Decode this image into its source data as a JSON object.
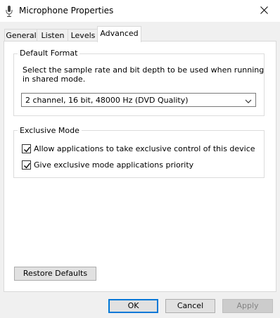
{
  "window": {
    "title": "Microphone Properties",
    "icon": "microphone-icon",
    "close_icon": "close-icon"
  },
  "tabs": [
    {
      "label": "General",
      "active": false
    },
    {
      "label": "Listen",
      "active": false
    },
    {
      "label": "Levels",
      "active": false
    },
    {
      "label": "Advanced",
      "active": true
    }
  ],
  "default_format": {
    "group_label": "Default Format",
    "description_line1": "Select the sample rate and bit depth to be used when running",
    "description_line2": "in shared mode.",
    "selected_format": "2 channel, 16 bit, 48000 Hz (DVD Quality)"
  },
  "exclusive_mode": {
    "group_label": "Exclusive Mode",
    "options": [
      {
        "label": "Allow applications to take exclusive control of this device",
        "checked": true
      },
      {
        "label": "Give exclusive mode applications priority",
        "checked": true
      }
    ]
  },
  "buttons": {
    "restore_defaults": "Restore Defaults",
    "ok": "OK",
    "cancel": "Cancel",
    "apply": "Apply"
  },
  "colors": {
    "accent": "#0078d7",
    "dialog_bg": "#f0f0f0",
    "panel_bg": "#ffffff"
  }
}
